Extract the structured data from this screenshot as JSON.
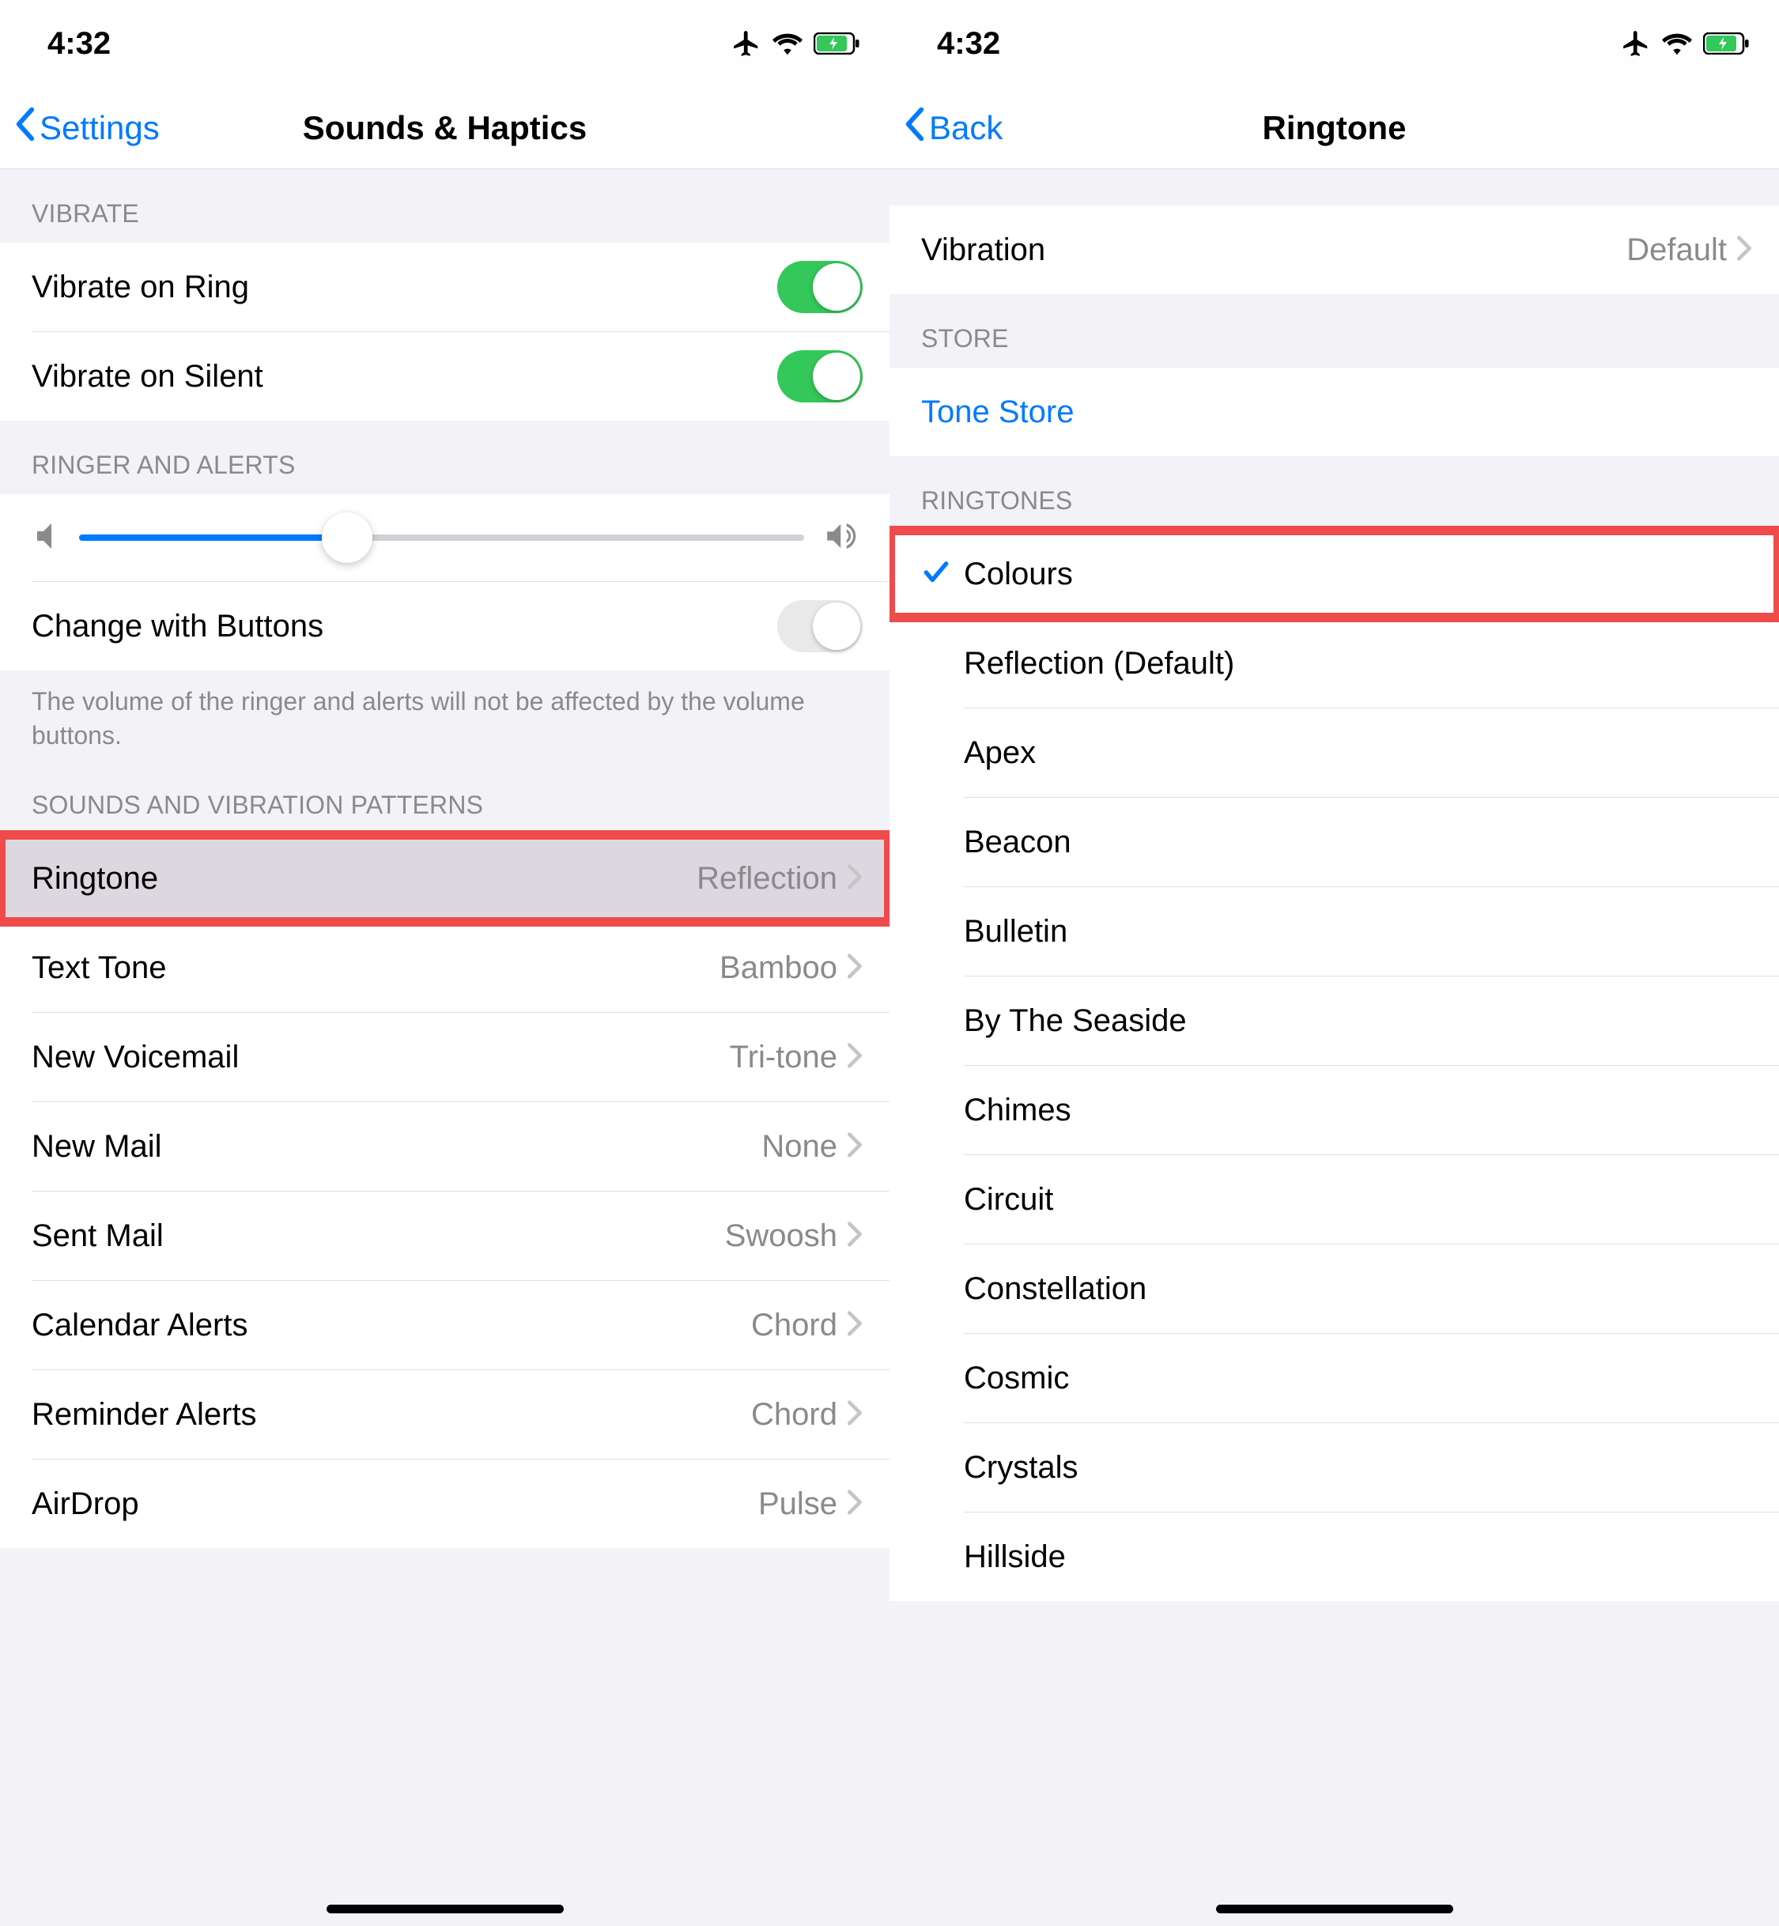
{
  "status": {
    "time": "4:32"
  },
  "left": {
    "nav": {
      "back": "Settings",
      "title": "Sounds & Haptics"
    },
    "sections": {
      "vibrate": {
        "header": "VIBRATE",
        "ring": "Vibrate on Ring",
        "silent": "Vibrate on Silent"
      },
      "ringer": {
        "header": "RINGER AND ALERTS",
        "slider_percent": 37,
        "change_buttons": "Change with Buttons",
        "footer": "The volume of the ringer and alerts will not be affected by the volume buttons."
      },
      "sounds": {
        "header": "SOUNDS AND VIBRATION PATTERNS",
        "items": [
          {
            "label": "Ringtone",
            "value": "Reflection",
            "highlight": true
          },
          {
            "label": "Text Tone",
            "value": "Bamboo"
          },
          {
            "label": "New Voicemail",
            "value": "Tri-tone"
          },
          {
            "label": "New Mail",
            "value": "None"
          },
          {
            "label": "Sent Mail",
            "value": "Swoosh"
          },
          {
            "label": "Calendar Alerts",
            "value": "Chord"
          },
          {
            "label": "Reminder Alerts",
            "value": "Chord"
          },
          {
            "label": "AirDrop",
            "value": "Pulse"
          }
        ]
      }
    }
  },
  "right": {
    "nav": {
      "back": "Back",
      "title": "Ringtone"
    },
    "vibration": {
      "label": "Vibration",
      "value": "Default"
    },
    "store": {
      "header": "STORE",
      "tone_store": "Tone Store"
    },
    "ringtones": {
      "header": "RINGTONES",
      "items": [
        {
          "label": "Colours",
          "selected": true,
          "highlight": true
        },
        {
          "label": "Reflection (Default)"
        },
        {
          "label": "Apex"
        },
        {
          "label": "Beacon"
        },
        {
          "label": "Bulletin"
        },
        {
          "label": "By The Seaside"
        },
        {
          "label": "Chimes"
        },
        {
          "label": "Circuit"
        },
        {
          "label": "Constellation"
        },
        {
          "label": "Cosmic"
        },
        {
          "label": "Crystals"
        },
        {
          "label": "Hillside"
        }
      ]
    }
  }
}
